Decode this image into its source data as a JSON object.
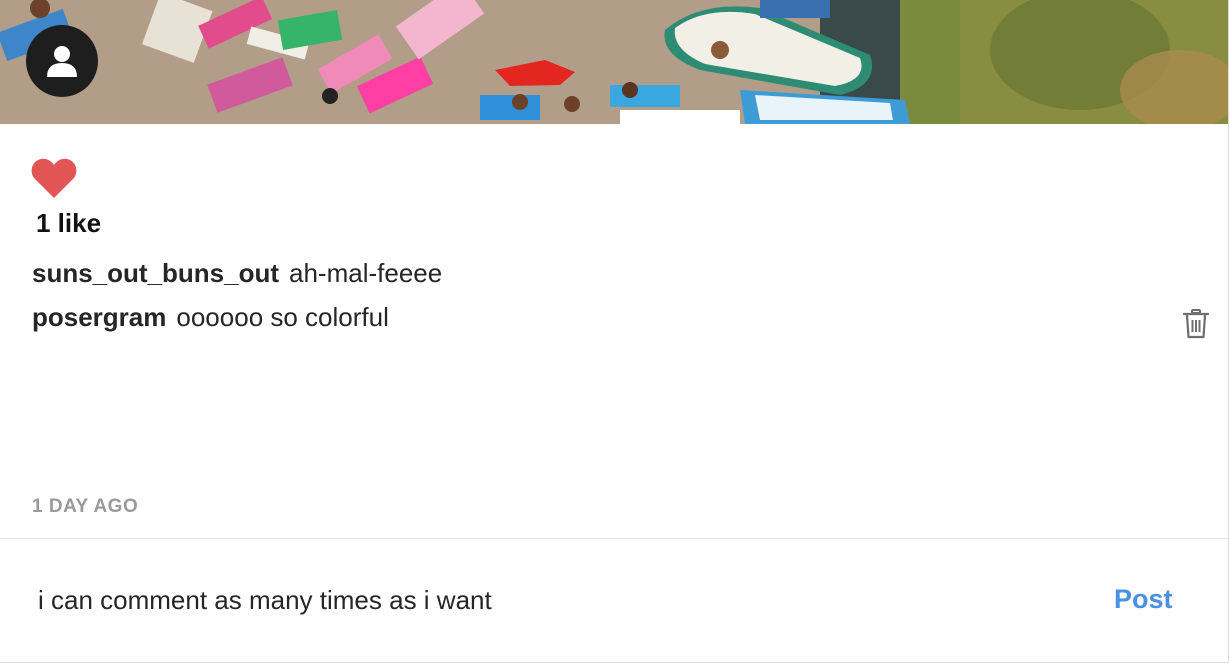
{
  "post": {
    "likes_text": "1 like",
    "comments": [
      {
        "username": "suns_out_buns_out",
        "text": "ah-mal-feeee"
      },
      {
        "username": "posergram",
        "text": "oooooo so colorful"
      }
    ],
    "timestamp": "1 DAY AGO"
  },
  "comment_box": {
    "value": "i can comment as many times as i want",
    "post_label": "Post"
  },
  "icons": {
    "avatar": "user-silhouette-icon",
    "like": "heart-icon",
    "delete": "trash-icon"
  },
  "colors": {
    "heart": "#e25555",
    "post_button": "#4a90e2",
    "timestamp": "#9a9a9a"
  }
}
